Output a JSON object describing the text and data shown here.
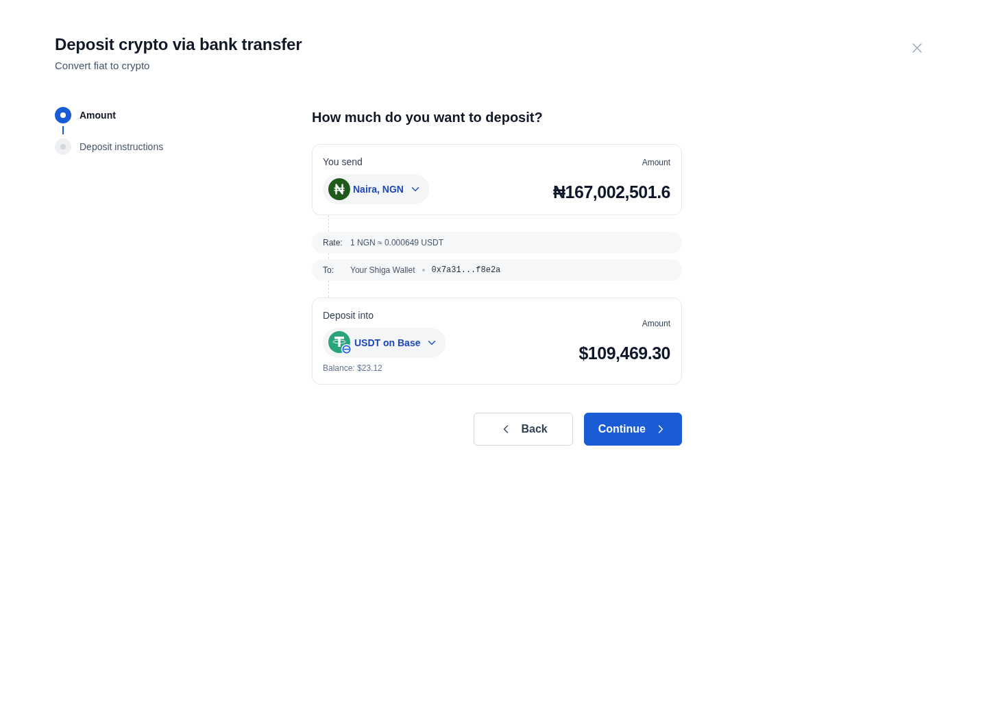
{
  "dialog": {
    "title": "Deposit crypto via bank transfer",
    "subtitle": "Convert fiat to crypto"
  },
  "steps": [
    {
      "label": "Amount",
      "selected": true
    },
    {
      "label": "Deposit instructions",
      "selected": false
    }
  ],
  "form": {
    "heading": "How much do you want to deposit?",
    "send": {
      "label": "You send",
      "currency": "Naira, NGN",
      "amount_label": "Amount",
      "amount": "₦167,002,501.6"
    },
    "rate": {
      "label": "Rate:",
      "value": "1 NGN ≈ 0.000649 USDT"
    },
    "destination": {
      "label": "To:",
      "wallet": "Your Shiga Wallet",
      "address": "0x7a31...f8e2a"
    },
    "receive": {
      "label": "Deposit into",
      "currency": "USDT on Base",
      "amount_label": "Amount",
      "amount": "$109,469.30",
      "balance": "Balance: $23.12"
    }
  },
  "buttons": [
    {
      "label": "Back",
      "kind": "secondary"
    },
    {
      "label": "Continue",
      "kind": "primary"
    }
  ]
}
